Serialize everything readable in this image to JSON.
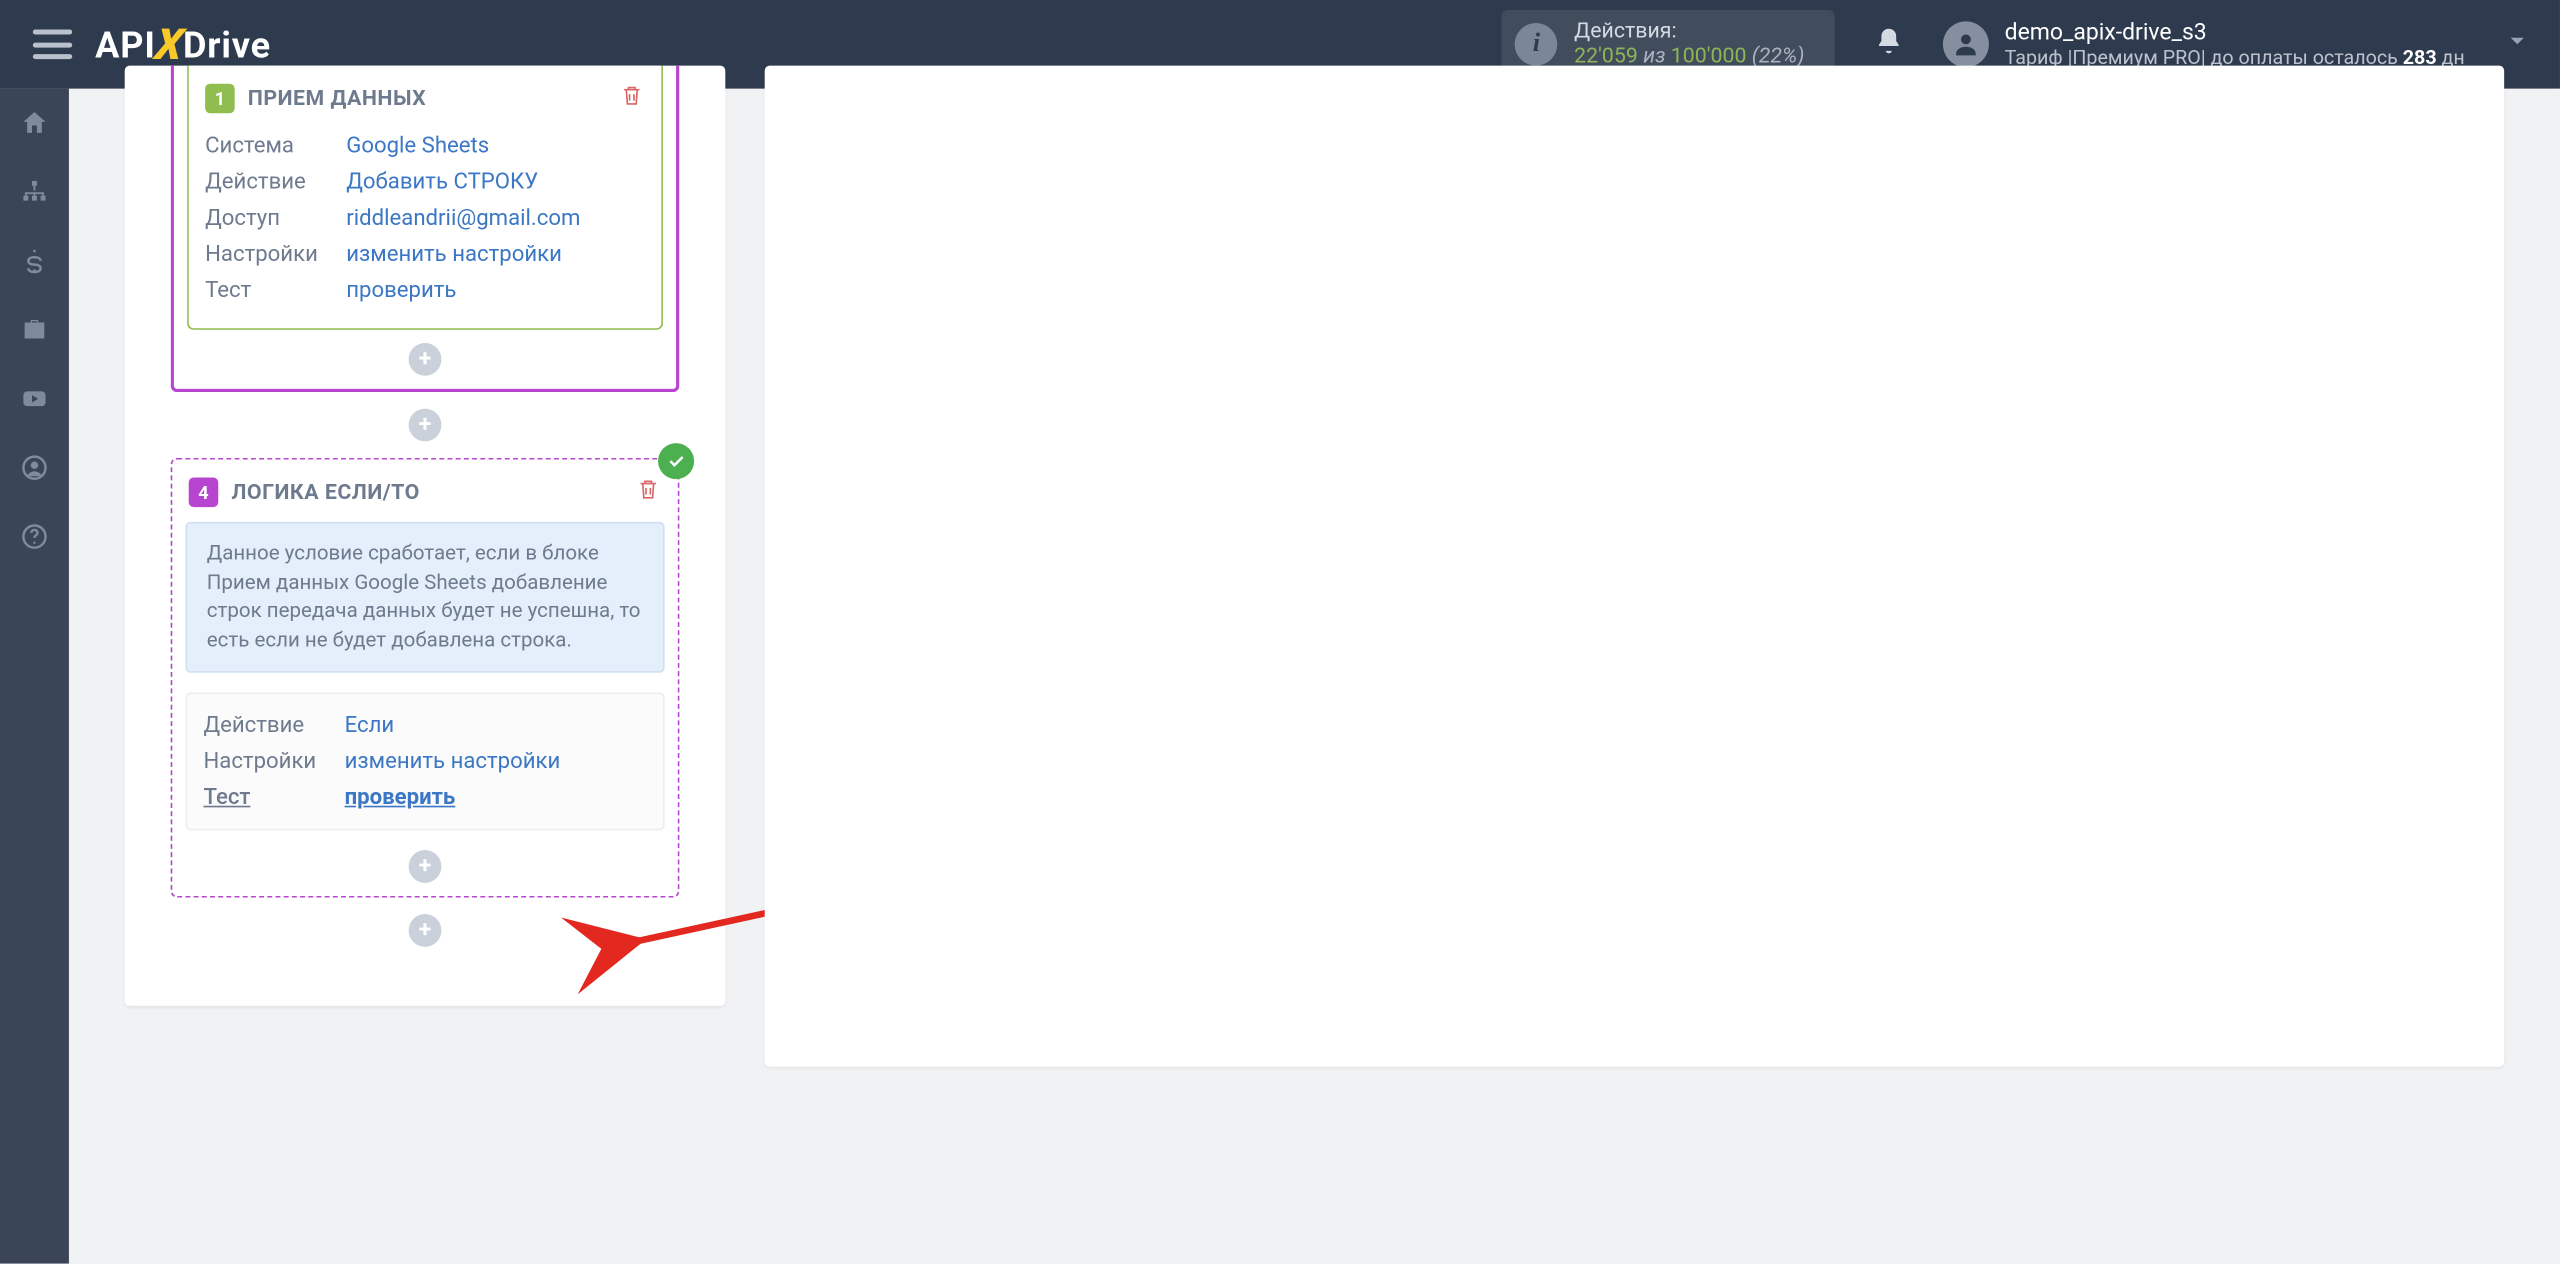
{
  "header": {
    "logo_pre": "API",
    "logo_post": "Drive",
    "actions_label": "Действия:",
    "actions_current": "22'059",
    "actions_iz": " из ",
    "actions_total": "100'000",
    "actions_pct": " (22%)",
    "username": "demo_apix-drive_s3",
    "tariff_pre": "Тариф |Премиум PRO| до оплаты осталось ",
    "tariff_days": "283",
    "tariff_suf": " дн"
  },
  "block1": {
    "num": "1",
    "title": "ПРИЕМ ДАННЫХ",
    "rows": [
      {
        "k": "Система",
        "v": "Google Sheets"
      },
      {
        "k": "Действие",
        "v": "Добавить СТРОКУ"
      },
      {
        "k": "Доступ",
        "v": "riddleandrii@gmail.com"
      },
      {
        "k": "Настройки",
        "v": "изменить настройки"
      },
      {
        "k": "Тест",
        "v": "проверить"
      }
    ]
  },
  "block2": {
    "num": "4",
    "title": "ЛОГИКА ЕСЛИ/ТО",
    "desc": "Данное условие сработает, если в блоке Прием данных Google Sheets добавление строк передача данных будет не успешна, то есть если не будет добавлена строка.",
    "rows": [
      {
        "k": "Действие",
        "v": "Если"
      },
      {
        "k": "Настройки",
        "v": "изменить настройки"
      },
      {
        "k": "Тест",
        "v": "проверить"
      }
    ]
  }
}
